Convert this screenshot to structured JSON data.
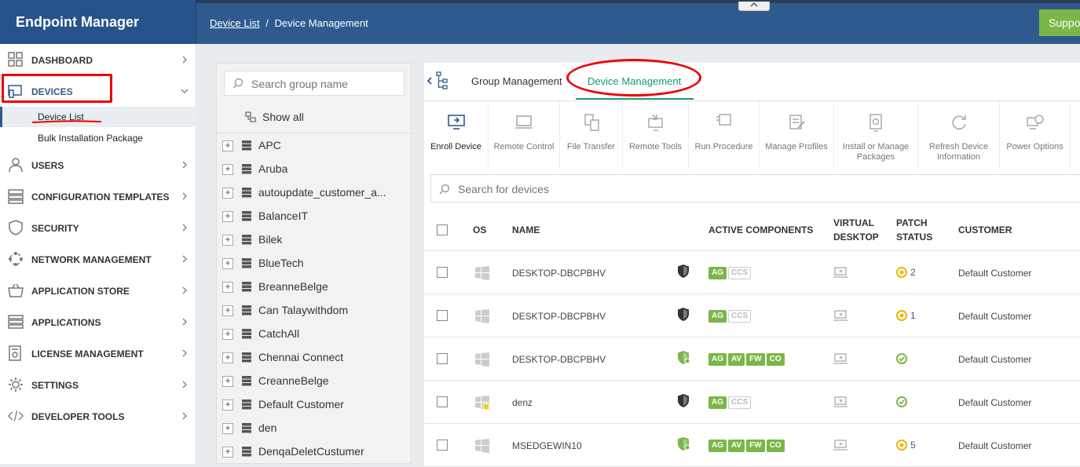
{
  "app": {
    "title": "Endpoint Manager"
  },
  "breadcrumb": {
    "parent": "Device List",
    "separator": "/",
    "current": "Device Management"
  },
  "header": {
    "support_label": "Support"
  },
  "sidebar": {
    "items": [
      {
        "label": "DASHBOARD",
        "icon": "dashboard-icon"
      },
      {
        "label": "DEVICES",
        "icon": "devices-icon"
      },
      {
        "label": "USERS",
        "icon": "user-icon"
      },
      {
        "label": "CONFIGURATION TEMPLATES",
        "icon": "templates-icon"
      },
      {
        "label": "SECURITY",
        "icon": "shield-icon"
      },
      {
        "label": "NETWORK MANAGEMENT",
        "icon": "network-icon"
      },
      {
        "label": "APPLICATION STORE",
        "icon": "store-icon"
      },
      {
        "label": "APPLICATIONS",
        "icon": "applications-icon"
      },
      {
        "label": "LICENSE MANAGEMENT",
        "icon": "license-icon"
      },
      {
        "label": "SETTINGS",
        "icon": "gear-icon"
      },
      {
        "label": "DEVELOPER TOOLS",
        "icon": "code-icon"
      }
    ],
    "sub_items": [
      {
        "label": "Device List",
        "active": true
      },
      {
        "label": "Bulk Installation Package",
        "active": false
      }
    ]
  },
  "groups": {
    "search_placeholder": "Search group name",
    "show_all_label": "Show all",
    "items": [
      "APC",
      "Aruba",
      "autoupdate_customer_a...",
      "BalanceIT",
      "Bilek",
      "BlueTech",
      "BreanneBelge",
      "Can Talaywithdom",
      "CatchAll",
      "Chennai Connect",
      "CreanneBelge",
      "Default Customer",
      "den",
      "DenqaDeletCustumer"
    ]
  },
  "tabs": [
    {
      "label": "Group Management",
      "active": false
    },
    {
      "label": "Device Management",
      "active": true
    }
  ],
  "toolbar": {
    "items": [
      {
        "label": "Enroll Device",
        "icon": "enroll-device-icon",
        "enabled": true
      },
      {
        "label": "Remote Control",
        "icon": "monitor-icon",
        "enabled": false
      },
      {
        "label": "File Transfer",
        "icon": "file-transfer-icon",
        "enabled": false
      },
      {
        "label": "Remote Tools",
        "icon": "remote-tools-icon",
        "enabled": false
      },
      {
        "label": "Run Procedure",
        "icon": "run-procedure-icon",
        "enabled": false
      },
      {
        "label": "Manage Profiles",
        "icon": "profiles-icon",
        "enabled": false
      },
      {
        "label": "Install or Manage Packages",
        "icon": "packages-icon",
        "enabled": false
      },
      {
        "label": "Refresh Device Information",
        "icon": "refresh-icon",
        "enabled": false
      },
      {
        "label": "Power Options",
        "icon": "power-icon",
        "enabled": false
      }
    ]
  },
  "device_search": {
    "placeholder": "Search for devices"
  },
  "table": {
    "columns": {
      "os": "OS",
      "name": "NAME",
      "active_components": "ACTIVE COMPONENTS",
      "virtual_desktop": "VIRTUAL DESKTOP",
      "patch_status": "PATCH STATUS",
      "customer": "CUSTOMER"
    },
    "rows": [
      {
        "name": "DESKTOP-DBCPBHV",
        "components": [
          "AG",
          "CCS"
        ],
        "components_on": [
          true,
          false
        ],
        "protected": false,
        "patch_status": "warning",
        "patch_count": "2",
        "customer": "Default Customer"
      },
      {
        "name": "DESKTOP-DBCPBHV",
        "components": [
          "AG",
          "CCS"
        ],
        "components_on": [
          true,
          false
        ],
        "protected": false,
        "patch_status": "warning",
        "patch_count": "1",
        "customer": "Default Customer"
      },
      {
        "name": "DESKTOP-DBCPBHV",
        "components": [
          "AG",
          "AV",
          "FW",
          "CO"
        ],
        "components_on": [
          true,
          true,
          true,
          true
        ],
        "protected": true,
        "patch_status": "ok",
        "patch_count": "",
        "customer": "Default Customer"
      },
      {
        "name": "denz",
        "components": [
          "AG",
          "CCS"
        ],
        "components_on": [
          true,
          false
        ],
        "protected": false,
        "patch_status": "ok",
        "patch_count": "",
        "customer": "Default Customer"
      },
      {
        "name": "MSEDGEWIN10",
        "components": [
          "AG",
          "AV",
          "FW",
          "CO"
        ],
        "components_on": [
          true,
          true,
          true,
          true
        ],
        "protected": true,
        "patch_status": "warning",
        "patch_count": "5",
        "customer": "Default Customer"
      }
    ]
  },
  "colors": {
    "header_blue": "#2f5a8e",
    "accent_green": "#129c6e",
    "badge_green": "#7ab648",
    "warning_yellow": "#f2b400",
    "highlight_red": "#e00000"
  }
}
